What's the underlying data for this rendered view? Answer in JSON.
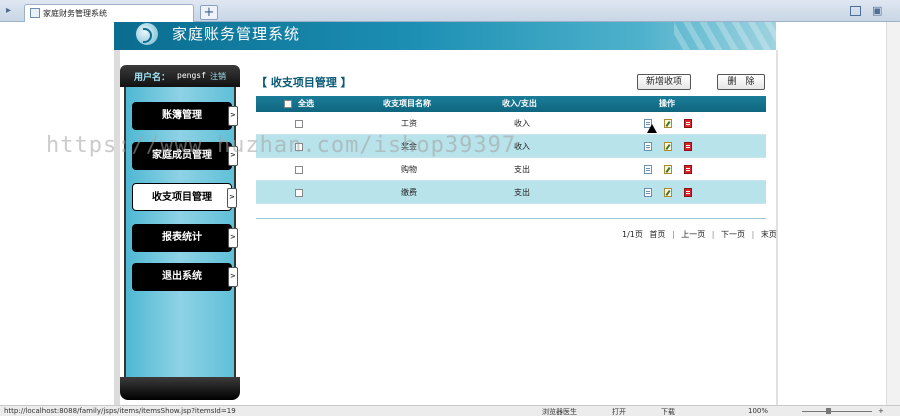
{
  "browser": {
    "tab_title": "家庭财务管理系统",
    "status_url": "http://localhost:8088/family/jsps/items/itemsShow.jsp?itemsId=19",
    "status_items": [
      "浏览器医生",
      "打开",
      "下载"
    ],
    "zoom": "100%"
  },
  "header": {
    "title": "家庭账务管理系统"
  },
  "sidebar": {
    "user_label": "用户名：",
    "username": "pengsf",
    "logout": "注销",
    "items": [
      {
        "label": "账簿管理"
      },
      {
        "label": "家庭成员管理"
      },
      {
        "label": "收支项目管理"
      },
      {
        "label": "报表统计"
      },
      {
        "label": "退出系统"
      }
    ]
  },
  "main": {
    "title": "【 收支项目管理 】",
    "add_button": "新增收项",
    "delete_button": "删　除",
    "columns": {
      "select_all": "全选",
      "name": "收支项目名称",
      "type": "收入/支出",
      "actions": "操作"
    },
    "rows": [
      {
        "name": "工资",
        "type": "收入"
      },
      {
        "name": "奖金",
        "type": "收入"
      },
      {
        "name": "购物",
        "type": "支出"
      },
      {
        "name": "缴费",
        "type": "支出"
      }
    ],
    "pager": {
      "info": "1/1页",
      "first": "首页",
      "prev": "上一页",
      "next": "下一页",
      "last": "末页"
    }
  },
  "watermark": "https://www.huzhan.com/ishop39397",
  "colors": {
    "accent": "#1b7d98",
    "row_alt": "#b8e3ea",
    "sidebar": "#4fb8d3"
  }
}
